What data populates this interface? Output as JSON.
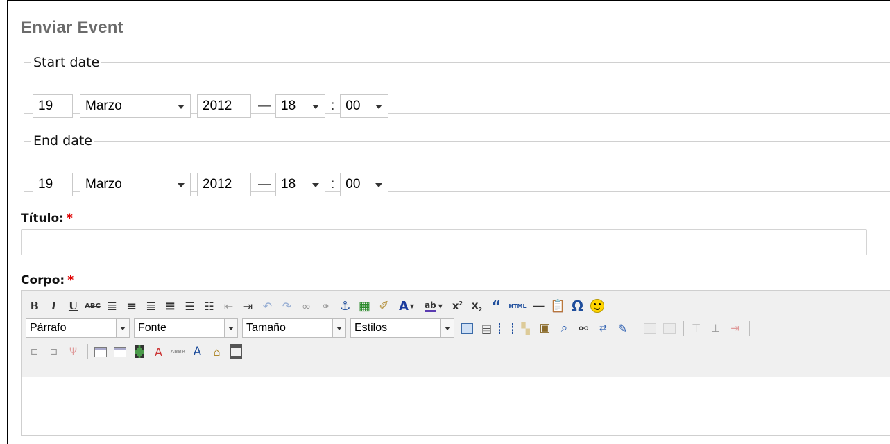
{
  "page_title": "Enviar Event",
  "start_date": {
    "legend": "Start date",
    "day": "19",
    "month": "Marzo",
    "year": "2012",
    "dash": "—",
    "hour": "18",
    "colon": ":",
    "minute": "00"
  },
  "end_date": {
    "legend": "End date",
    "day": "19",
    "month": "Marzo",
    "year": "2012",
    "dash": "—",
    "hour": "18",
    "colon": ":",
    "minute": "00"
  },
  "title_field": {
    "label": "Título:",
    "required_mark": "*",
    "value": ""
  },
  "body_field": {
    "label": "Corpo:",
    "required_mark": "*"
  },
  "editor": {
    "format_select": "Párrafo",
    "font_select": "Fonte",
    "size_select": "Tamaño",
    "styles_select": "Estilos",
    "html_button": "HTML"
  },
  "colors": {
    "title": "#6b6b6b",
    "required": "#e00000",
    "toolbar_bg": "#f0f0f0"
  }
}
